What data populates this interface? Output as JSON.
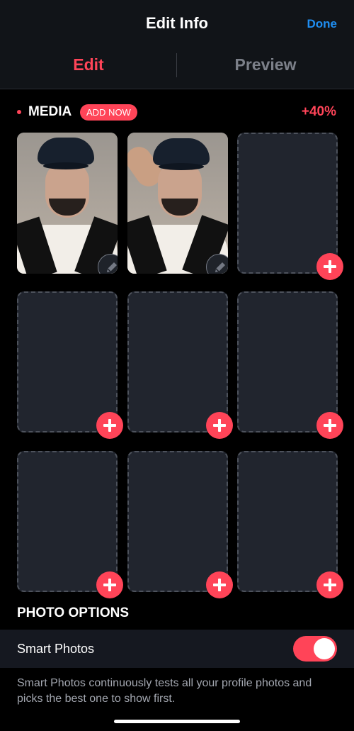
{
  "header": {
    "title": "Edit Info",
    "done_label": "Done",
    "tabs": [
      {
        "label": "Edit",
        "active": true
      },
      {
        "label": "Preview",
        "active": false
      }
    ]
  },
  "media": {
    "label": "MEDIA",
    "add_now_label": "ADD NOW",
    "completion_percent": "+40%",
    "slots": [
      {
        "state": "photo",
        "action_icon": "pencil-icon"
      },
      {
        "state": "photo",
        "action_icon": "pencil-icon"
      },
      {
        "state": "empty",
        "action_icon": "plus-icon"
      },
      {
        "state": "empty",
        "action_icon": "plus-icon"
      },
      {
        "state": "empty",
        "action_icon": "plus-icon"
      },
      {
        "state": "empty",
        "action_icon": "plus-icon"
      },
      {
        "state": "empty",
        "action_icon": "plus-icon"
      },
      {
        "state": "empty",
        "action_icon": "plus-icon"
      },
      {
        "state": "empty",
        "action_icon": "plus-icon"
      }
    ]
  },
  "photo_options": {
    "heading": "PHOTO OPTIONS",
    "smart_photos": {
      "label": "Smart Photos",
      "enabled": true,
      "description": "Smart Photos continuously tests all your profile photos and picks the best one to show first."
    }
  },
  "colors": {
    "accent": "#ff4458",
    "link": "#1f8ef1",
    "background": "#000000",
    "surface": "#21252e"
  }
}
